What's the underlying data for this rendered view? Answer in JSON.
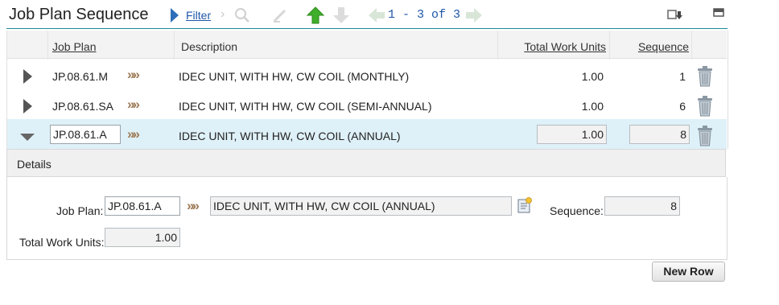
{
  "header": {
    "title": "Job Plan Sequence",
    "filter_label": "Filter",
    "pager": "1 - 3 of 3"
  },
  "table": {
    "columns": [
      "Job Plan",
      "Description",
      "Total Work Units",
      "Sequence"
    ],
    "rows": [
      {
        "job_plan": "JP.08.61.M",
        "description": "IDEC UNIT, WITH HW, CW COIL (MONTHLY)",
        "total_work_units": "1.00",
        "sequence": "1"
      },
      {
        "job_plan": "JP.08.61.SA",
        "description": "IDEC UNIT, WITH HW, CW COIL (SEMI-ANNUAL)",
        "total_work_units": "1.00",
        "sequence": "6"
      },
      {
        "job_plan": "JP.08.61.A",
        "description": "IDEC UNIT, WITH HW, CW COIL (ANNUAL)",
        "total_work_units": "1.00",
        "sequence": "8"
      }
    ]
  },
  "details": {
    "title": "Details",
    "job_plan_label": "Job Plan:",
    "job_plan_value": "JP.08.61.A",
    "description_value": "IDEC UNIT, WITH HW, CW COIL (ANNUAL)",
    "sequence_label": "Sequence:",
    "sequence_value": "8",
    "total_work_units_label": "Total Work Units:",
    "total_work_units_value": "1.00"
  },
  "actions": {
    "new_row_label": "New Row"
  },
  "colors": {
    "accent_line": "#1f8a94",
    "link": "#1f57a8",
    "selected_row": "#dff1f8",
    "up_arrow": "#3fae2a"
  }
}
